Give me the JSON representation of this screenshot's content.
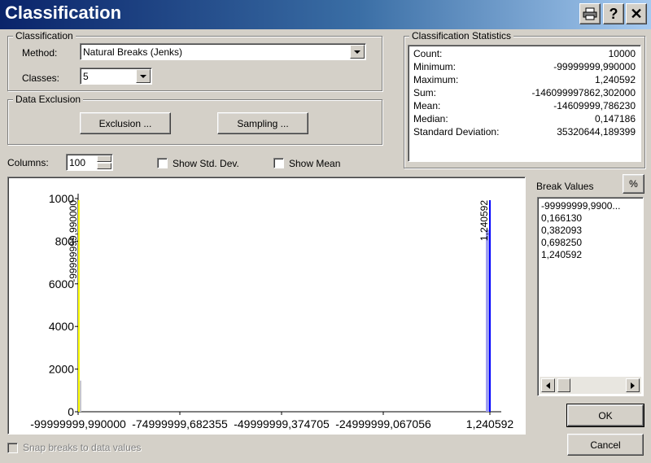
{
  "window": {
    "title": "Classification",
    "buttons": {
      "print_icon": "printer-icon",
      "help": "?",
      "close": "✕"
    }
  },
  "classification": {
    "group_label": "Classification",
    "method_label": "Method:",
    "method_value": "Natural Breaks (Jenks)",
    "classes_label": "Classes:",
    "classes_value": "5"
  },
  "data_exclusion": {
    "group_label": "Data Exclusion",
    "exclusion_button": "Exclusion ...",
    "sampling_button": "Sampling ..."
  },
  "statistics": {
    "group_label": "Classification Statistics",
    "rows": [
      {
        "label": "Count:",
        "value": "10000"
      },
      {
        "label": "Minimum:",
        "value": "-99999999,990000"
      },
      {
        "label": "Maximum:",
        "value": "1,240592"
      },
      {
        "label": "Sum:",
        "value": "-146099997862,302000"
      },
      {
        "label": "Mean:",
        "value": "-14609999,786230"
      },
      {
        "label": "Median:",
        "value": "0,147186"
      },
      {
        "label": "Standard Deviation:",
        "value": "35320644,189399"
      }
    ]
  },
  "options": {
    "columns_label": "Columns:",
    "columns_value": "100",
    "show_std_dev": "Show Std. Dev.",
    "show_mean": "Show Mean",
    "snap_breaks": "Snap breaks to data values"
  },
  "break_values": {
    "label": "Break Values",
    "percent_button": "%",
    "items": [
      "-99999999,9900...",
      "0,166130",
      "0,382093",
      "0,698250",
      "1,240592"
    ]
  },
  "actions": {
    "ok": "OK",
    "cancel": "Cancel"
  },
  "colors": {
    "title_start": "#0a246a",
    "title_end": "#a6caf0",
    "break_line": "#0000ff",
    "min_line": "#ffff00",
    "bar": "#a0a0f0"
  },
  "chart_data": {
    "type": "bar",
    "y_ticks": [
      "1000",
      "800",
      "6000",
      "4000",
      "2000",
      "0"
    ],
    "x_ticks": [
      "-99999999,990000",
      "-74999999,682355",
      "-49999999,374705",
      "-24999999,067056",
      "1,240592"
    ],
    "bars": [
      {
        "x": -99999999.99,
        "count": 1460
      },
      {
        "x": 1.240592,
        "count": 8540
      }
    ],
    "break_lines": [
      {
        "value": -99999999.99,
        "label": "-99999999,990000",
        "color": "#ffff00"
      },
      {
        "value": 1.240592,
        "label": "1,240592",
        "color": "#0000ff"
      }
    ],
    "xlim": [
      -99999999.99,
      1.240592
    ],
    "ylim": [
      0,
      10000
    ]
  }
}
